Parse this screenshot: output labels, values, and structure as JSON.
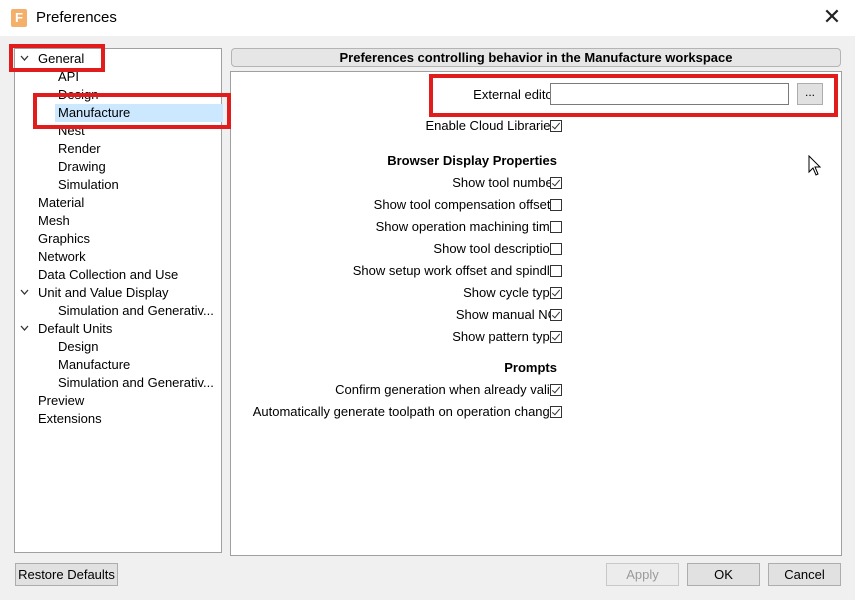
{
  "window": {
    "title": "Preferences",
    "app_icon_glyph": "F",
    "close_glyph": "✕"
  },
  "tree": {
    "items": [
      {
        "label": "General",
        "expanded": true
      },
      {
        "label": "API"
      },
      {
        "label": "Design"
      },
      {
        "label": "Manufacture",
        "selected": true
      },
      {
        "label": "Nest"
      },
      {
        "label": "Render"
      },
      {
        "label": "Drawing"
      },
      {
        "label": "Simulation"
      },
      {
        "label": "Material"
      },
      {
        "label": "Mesh"
      },
      {
        "label": "Graphics"
      },
      {
        "label": "Network"
      },
      {
        "label": "Data Collection and Use"
      },
      {
        "label": "Unit and Value Display",
        "expanded": true
      },
      {
        "label": "Simulation and Generativ..."
      },
      {
        "label": "Default Units",
        "expanded": true
      },
      {
        "label": "Design"
      },
      {
        "label": "Manufacture"
      },
      {
        "label": "Simulation and Generativ..."
      },
      {
        "label": "Preview"
      },
      {
        "label": "Extensions"
      }
    ]
  },
  "panel": {
    "header": "Preferences controlling behavior in the Manufacture workspace",
    "external_editor": {
      "label": "External editor",
      "value": "",
      "browse_label": "..."
    },
    "cloud_libraries": {
      "label": "Enable Cloud Libraries",
      "checked": true
    },
    "browser_display": {
      "heading": "Browser Display Properties",
      "options": [
        {
          "label": "Show tool number",
          "checked": true
        },
        {
          "label": "Show tool compensation offsets",
          "checked": false
        },
        {
          "label": "Show operation machining time",
          "checked": false
        },
        {
          "label": "Show tool description",
          "checked": false
        },
        {
          "label": "Show setup work offset and spindle",
          "checked": false
        },
        {
          "label": "Show cycle type",
          "checked": true
        },
        {
          "label": "Show manual NC",
          "checked": true
        },
        {
          "label": "Show pattern type",
          "checked": true
        }
      ]
    },
    "prompts": {
      "heading": "Prompts",
      "options": [
        {
          "label": "Confirm generation when already valid",
          "checked": true
        },
        {
          "label": "Automatically generate toolpath on operation change",
          "checked": true
        }
      ]
    }
  },
  "buttons": {
    "restore_defaults": "Restore Defaults",
    "apply": "Apply",
    "ok": "OK",
    "cancel": "Cancel"
  },
  "colors": {
    "highlight": "#e01c1c",
    "selection": "#cce8ff"
  }
}
